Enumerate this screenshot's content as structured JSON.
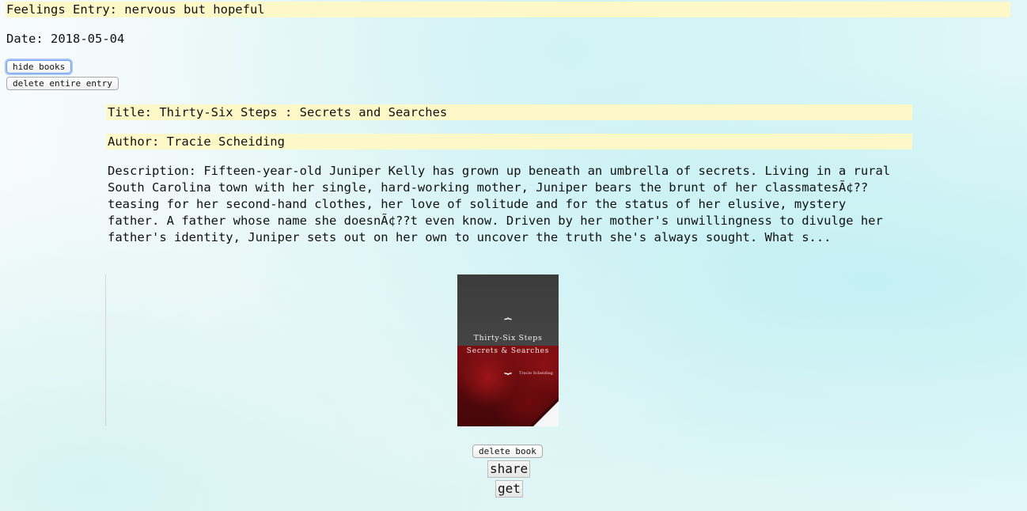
{
  "entry": {
    "feelings_label": "Feelings Entry: nervous but hopeful",
    "date_label": "Date: 2018-05-04",
    "hide_books_button": "hide books",
    "delete_entry_button": "delete entire entry"
  },
  "book": {
    "title_label": "Title: Thirty-Six Steps : Secrets and Searches",
    "author_label": "Author: Tracie Scheiding",
    "description_label": "Description: Fifteen-year-old Juniper Kelly has grown up beneath an umbrella of secrets. Living in a rural South Carolina town with her single, hard-working mother, Juniper bears the brunt of her classmatesÃ¢?? teasing for her second-hand clothes, her love of solitude and for the status of her elusive, mystery father. A father whose name she doesnÃ¢??t even know. Driven by her mother's unwillingness to divulge her father's identity, Juniper sets out on her own to uncover the truth she's always sought. What s...",
    "cover": {
      "brace_top": "⏞",
      "brace_bottom": "⏟",
      "title": "Thirty-Six Steps",
      "subtitle": "Secrets & Searches",
      "author": "Tracie Scheiding"
    },
    "delete_book_button": "delete book",
    "share_button": "share",
    "get_button": "get"
  },
  "colors": {
    "highlight": "#fdf8c8",
    "focus_ring": "#6ea0f0",
    "cover_dark": "#3f3f3f",
    "cover_red": "#7e0e12"
  }
}
